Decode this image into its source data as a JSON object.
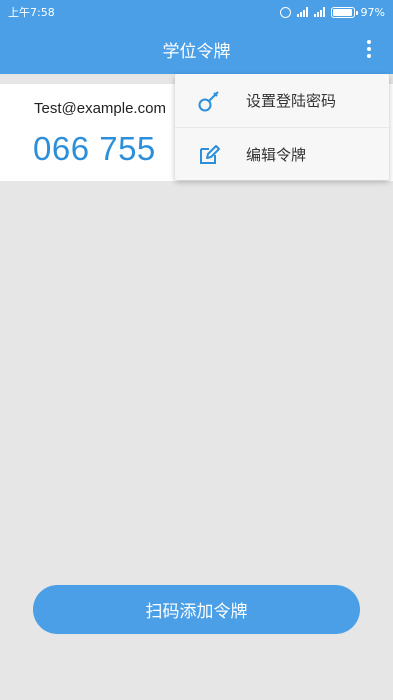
{
  "status_bar": {
    "time": "上午7:58",
    "battery_percent": "97%",
    "battery_level": 0.97
  },
  "app_bar": {
    "title": "学位令牌",
    "more_icon": "more-vert-icon"
  },
  "token": {
    "account": "Test@example.com",
    "code": "066 755"
  },
  "menu": {
    "items": [
      {
        "label": "设置登陆密码",
        "icon": "key-icon"
      },
      {
        "label": "编辑令牌",
        "icon": "edit-icon"
      }
    ]
  },
  "bottom": {
    "scan_label": "扫码添加令牌"
  },
  "colors": {
    "primary": "#4a9fe6",
    "code_text": "#2d8fd9",
    "background": "#e6e6e6"
  }
}
